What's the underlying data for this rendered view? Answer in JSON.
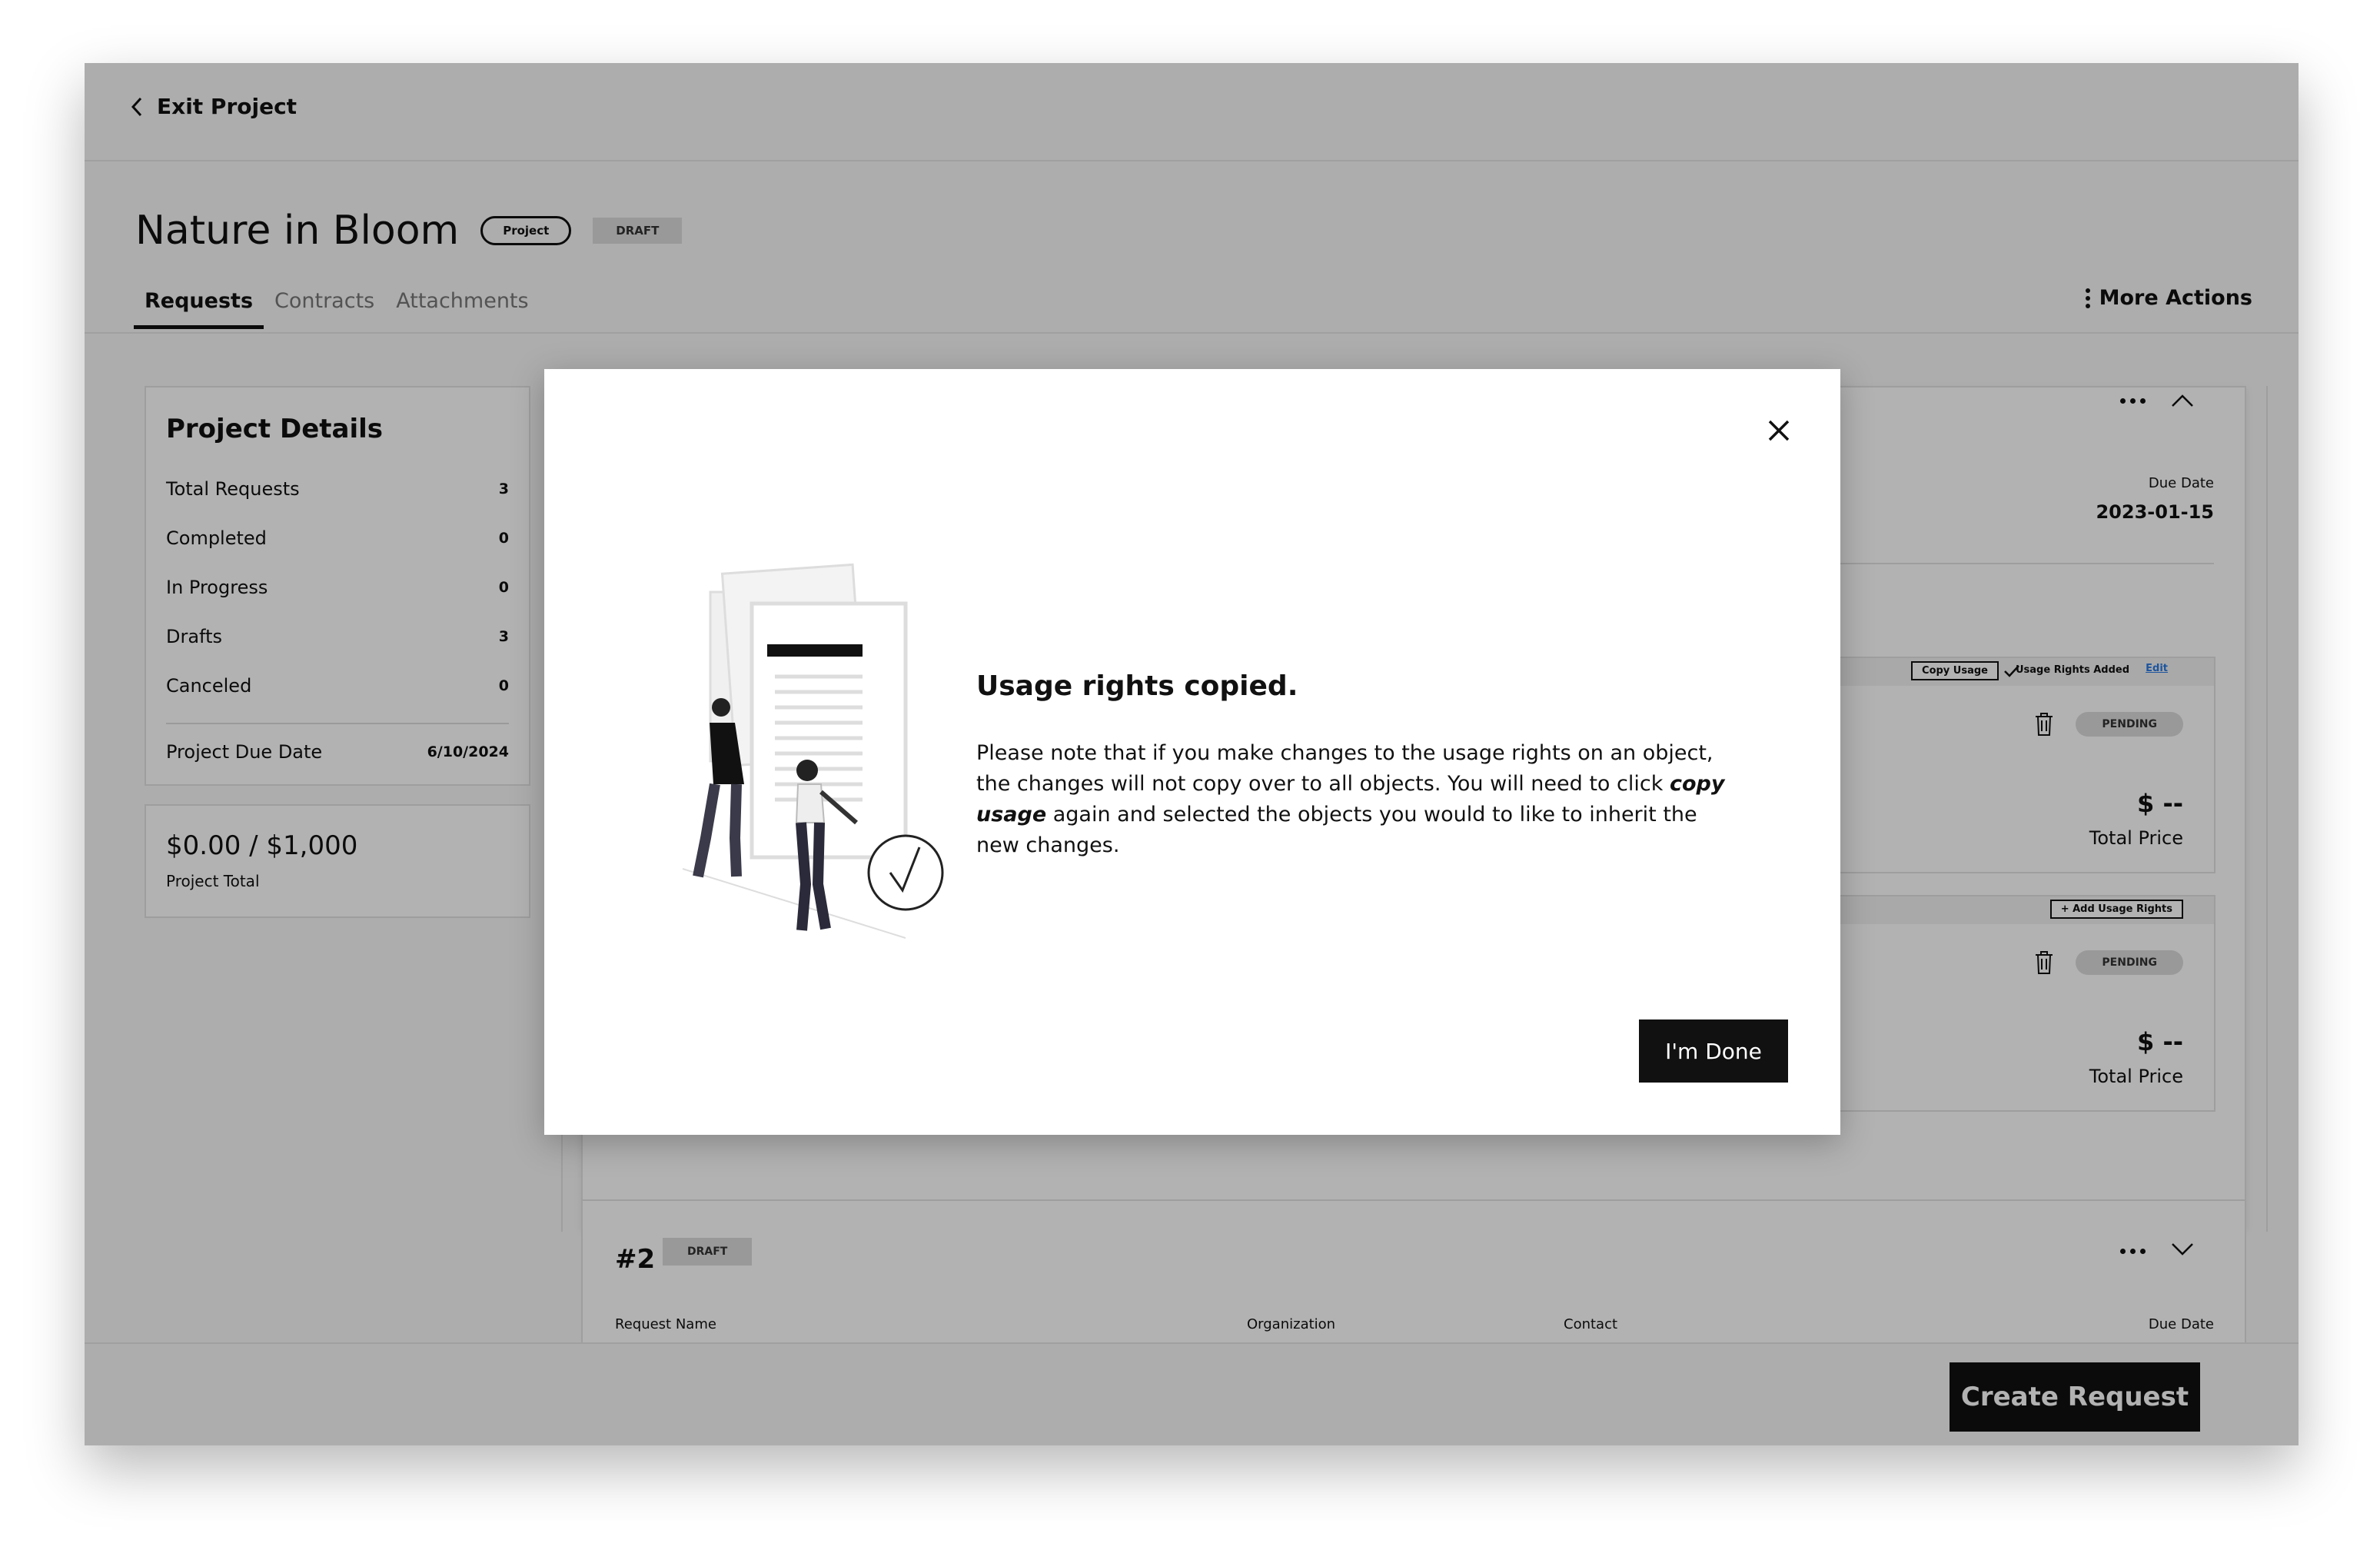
{
  "header": {
    "exit_label": "Exit Project",
    "project_title": "Nature in Bloom",
    "type_pill": "Project",
    "status_badge": "DRAFT",
    "more_actions": "More Actions"
  },
  "tabs": [
    {
      "label": "Requests",
      "active": true
    },
    {
      "label": "Contracts",
      "active": false
    },
    {
      "label": "Attachments",
      "active": false
    }
  ],
  "project_details": {
    "heading": "Project Details",
    "rows": [
      {
        "label": "Total Requests",
        "value": "3"
      },
      {
        "label": "Completed",
        "value": "0"
      },
      {
        "label": "In Progress",
        "value": "0"
      },
      {
        "label": "Drafts",
        "value": "3"
      },
      {
        "label": "Canceled",
        "value": "0"
      }
    ],
    "due_label": "Project Due Date",
    "due_value": "6/10/2024"
  },
  "project_total": {
    "amount": "$0.00 / $1,000",
    "label": "Project Total"
  },
  "request_1": {
    "due_label": "Due Date",
    "due_value": "2023-01-15",
    "object_1": {
      "copy_usage": "Copy Usage",
      "usage_added": "Usage Rights Added",
      "edit": "Edit",
      "status": "PENDING",
      "price": "$ --",
      "price_label": "Total Price"
    },
    "object_2": {
      "add_usage": "+ Add Usage Rights",
      "status": "PENDING",
      "price": "$ --",
      "price_label": "Total Price"
    }
  },
  "request_2": {
    "number": "#2",
    "status": "DRAFT",
    "columns": [
      "Request Name",
      "Organization",
      "Contact",
      "Due Date"
    ]
  },
  "footer": {
    "create_label": "Create Request"
  },
  "modal": {
    "title": "Usage rights copied.",
    "body_before": "Please note that if you make changes to the usage rights on an object, the changes will not copy over to all objects. You will need to click ",
    "body_emphasis": "copy usage",
    "body_after": " again and selected the objects you would to like to inherit the new changes.",
    "done_label": "I'm Done"
  },
  "colors": {
    "primary": "#111111",
    "badge_bg": "#dcdcdc",
    "link": "#2a7ae2"
  }
}
